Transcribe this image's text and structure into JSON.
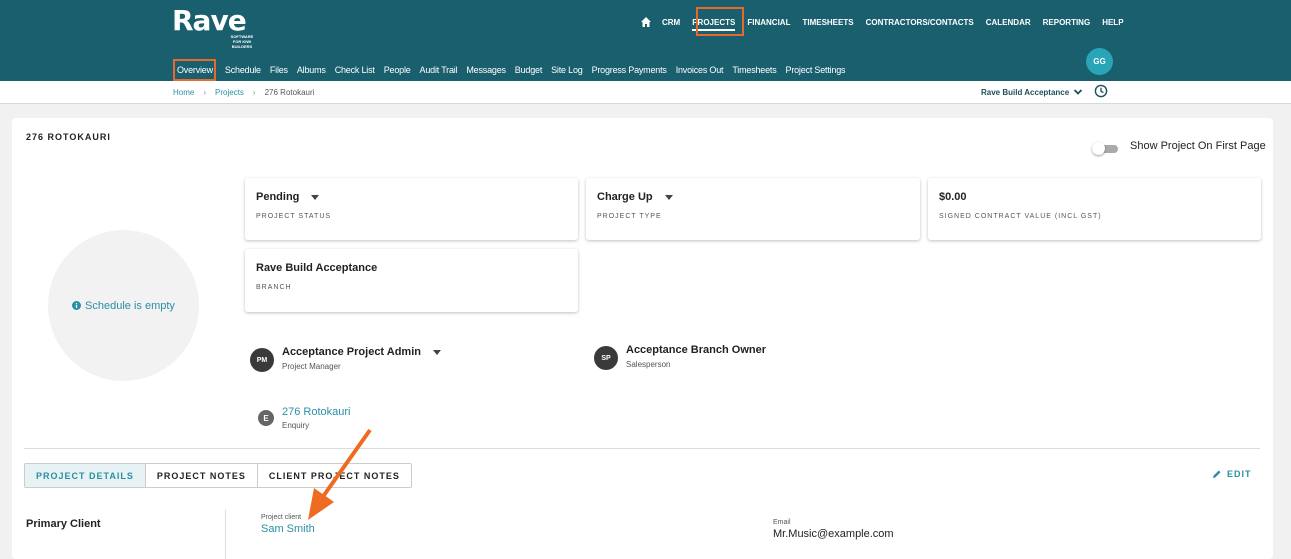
{
  "brand": {
    "name": "Rave",
    "tagline": "SOFTWARE FOR KIWI BUILDERS"
  },
  "main_nav": [
    "CRM",
    "PROJECTS",
    "FINANCIAL",
    "TIMESHEETS",
    "CONTRACTORS/CONTACTS",
    "CALENDAR",
    "REPORTING",
    "HELP"
  ],
  "user": {
    "initials": "GG"
  },
  "sub_nav": [
    "Overview",
    "Schedule",
    "Files",
    "Albums",
    "Check List",
    "People",
    "Audit Trail",
    "Messages",
    "Budget",
    "Site Log",
    "Progress Payments",
    "Invoices Out",
    "Timesheets",
    "Project Settings"
  ],
  "breadcrumb": {
    "home": "Home",
    "projects": "Projects",
    "current": "276 Rotokauri"
  },
  "branch_selector": "Rave Build Acceptance",
  "project": {
    "title": "276 ROTOKAURI",
    "show_first_page_label": "Show Project On First Page",
    "schedule_empty": "Schedule is empty"
  },
  "stats": {
    "status": {
      "value": "Pending",
      "label": "PROJECT STATUS"
    },
    "type": {
      "value": "Charge Up",
      "label": "PROJECT TYPE"
    },
    "contract": {
      "value": "$0.00",
      "label": "SIGNED CONTRACT VALUE (INCL GST)"
    },
    "branch": {
      "value": "Rave Build Acceptance",
      "label": "BRANCH"
    }
  },
  "people": {
    "manager": {
      "initials": "PM",
      "name": "Acceptance Project Admin",
      "role": "Project Manager"
    },
    "salesperson": {
      "initials": "SP",
      "name": "Acceptance Branch Owner",
      "role": "Salesperson"
    }
  },
  "enquiry": {
    "initials": "E",
    "name": "276 Rotokauri",
    "role": "Enquiry"
  },
  "tabs": [
    "PROJECT DETAILS",
    "PROJECT NOTES",
    "CLIENT PROJECT NOTES"
  ],
  "edit_label": "EDIT",
  "details": {
    "section": "Primary Client",
    "client_label": "Project client",
    "client_value": "Sam Smith",
    "email_label": "Email",
    "email_value": "Mr.Music@example.com"
  },
  "colors": {
    "header": "#195f6e",
    "accent": "#2aa4b7",
    "link": "#2a8fa3",
    "highlight": "#e8692c"
  }
}
